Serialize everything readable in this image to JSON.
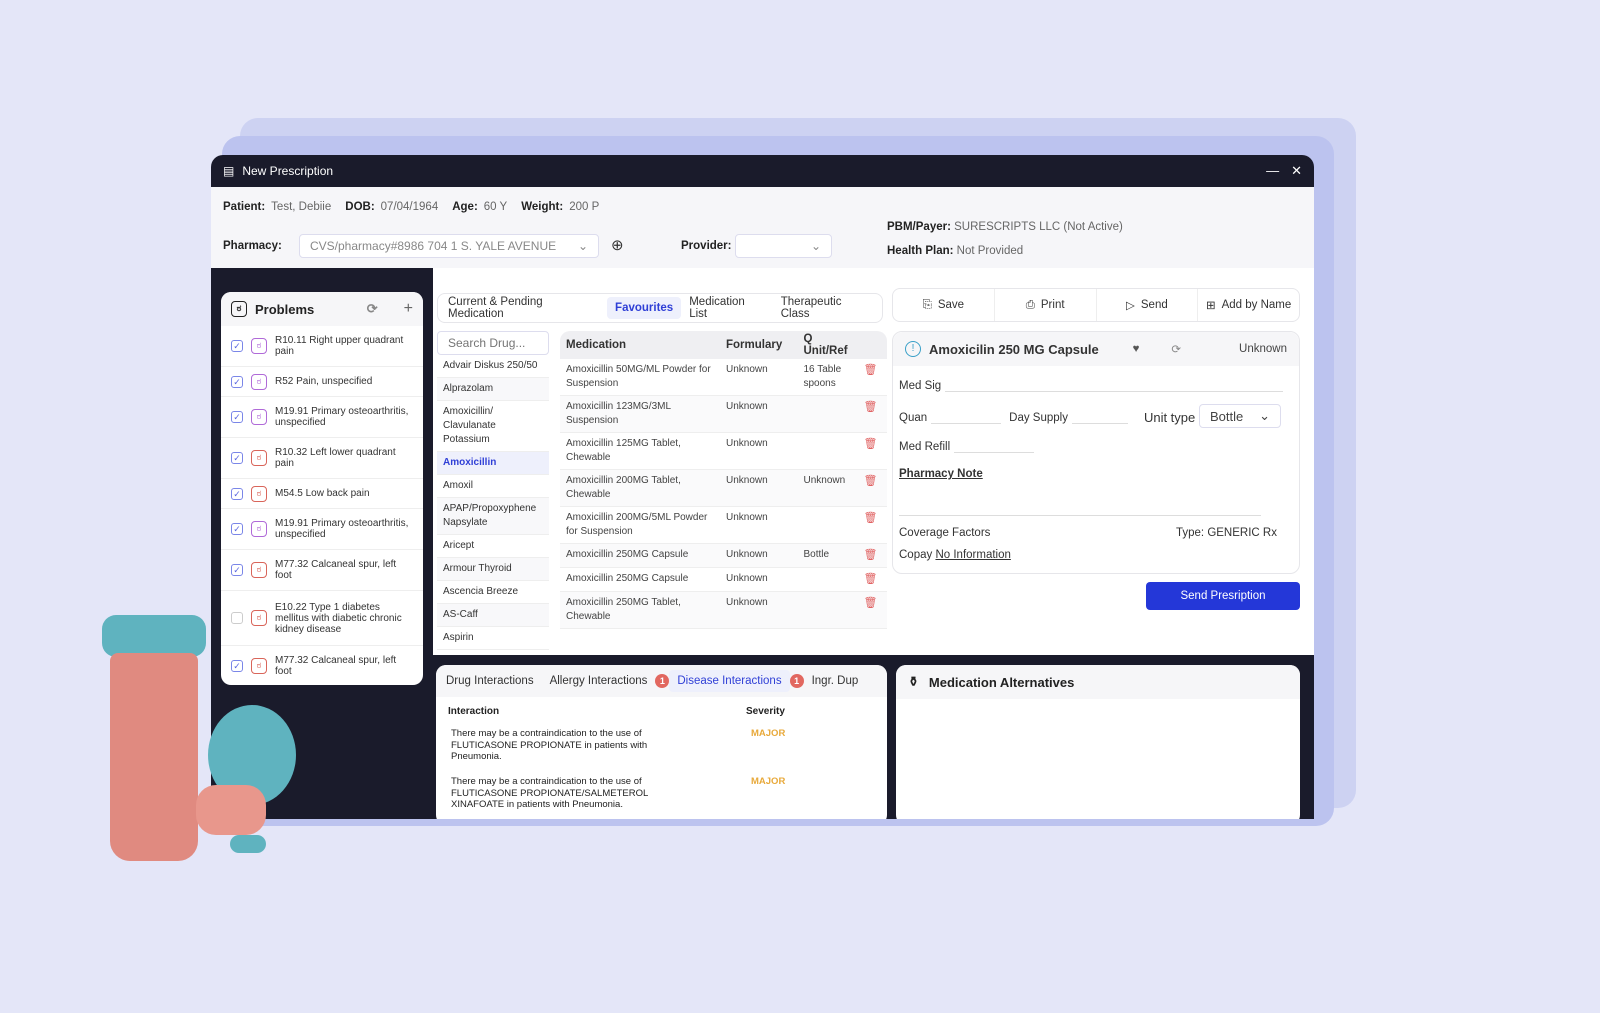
{
  "window": {
    "title": "New Prescription"
  },
  "patient": {
    "patient_label": "Patient:",
    "patient": "Test, Debiie",
    "dob_label": "DOB:",
    "dob": "07/04/1964",
    "age_label": "Age:",
    "age": "60 Y",
    "weight_label": "Weight:",
    "weight": "200 P"
  },
  "pharmacy": {
    "label": "Pharmacy:",
    "value": "CVS/pharmacy#8986 704 1 S. YALE AVENUE",
    "provider_label": "Provider:",
    "provider_value": ""
  },
  "payer": {
    "pbm_label": "PBM/Payer:",
    "pbm": "SURESCRIPTS LLC (Not Active)",
    "plan_label": "Health Plan:",
    "plan": "Not Provided"
  },
  "problems": {
    "title": "Problems",
    "items": [
      {
        "text": "R10.11 Right upper quadrant pain",
        "checked": true,
        "color": "#b06ad8"
      },
      {
        "text": "R52 Pain, unspecified",
        "checked": true,
        "color": "#b06ad8"
      },
      {
        "text": "M19.91 Primary osteoarthritis, unspecified",
        "checked": true,
        "color": "#b06ad8"
      },
      {
        "text": "R10.32 Left lower quadrant pain",
        "checked": true,
        "color": "#d9655a"
      },
      {
        "text": "M54.5 Low back pain",
        "checked": true,
        "color": "#d9655a"
      },
      {
        "text": "M19.91 Primary osteoarthritis, unspecified",
        "checked": true,
        "color": "#b06ad8"
      },
      {
        "text": "M77.32 Calcaneal spur, left foot",
        "checked": true,
        "color": "#d9655a"
      },
      {
        "text": "E10.22 Type 1 diabetes mellitus with diabetic chronic kidney disease",
        "checked": false,
        "color": "#d9655a"
      },
      {
        "text": "M77.32 Calcaneal spur, left foot",
        "checked": true,
        "color": "#d9655a"
      }
    ]
  },
  "med_tabs": [
    {
      "label": "Current & Pending Medication"
    },
    {
      "label": "Favourites",
      "active": true
    },
    {
      "label": "Medication List"
    },
    {
      "label": "Therapeutic Class"
    }
  ],
  "search": {
    "placeholder": "Search Drug..."
  },
  "drugs": [
    "Advair Diskus 250/50",
    "Alprazolam",
    "Amoxicillin/ Clavulanate Potassium",
    "Amoxicillin",
    "Amoxil",
    "APAP/Propoxyphene Napsylate",
    "Aricept",
    "Armour Thyroid",
    "Ascencia Breeze",
    "AS-Caff",
    "Aspirin"
  ],
  "selected_drug": "Amoxicillin",
  "med_table": {
    "headers": [
      "Medication",
      "Formulary",
      "Q Unit/Ref"
    ],
    "rows": [
      [
        "Amoxicillin 50MG/ML Powder for Suspension",
        "Unknown",
        "16 Table spoons"
      ],
      [
        "Amoxicillin 123MG/3ML Suspension",
        "Unknown",
        ""
      ],
      [
        "Amoxicillin 125MG Tablet, Chewable",
        "Unknown",
        ""
      ],
      [
        "Amoxicillin 200MG Tablet, Chewable",
        "Unknown",
        "Unknown"
      ],
      [
        "Amoxicillin 200MG/5ML Powder for Suspension",
        "Unknown",
        ""
      ],
      [
        "Amoxicillin 250MG Capsule",
        "Unknown",
        "Bottle"
      ],
      [
        "Amoxicillin 250MG Capsule",
        "Unknown",
        ""
      ],
      [
        "Amoxicillin 250MG Tablet, Chewable",
        "Unknown",
        ""
      ]
    ]
  },
  "actions": {
    "save": "Save",
    "print": "Print",
    "send": "Send",
    "add": "Add by Name"
  },
  "detail": {
    "title": "Amoxicilin 250 MG Capsule",
    "status": "Unknown",
    "med_sig": "Med Sig",
    "quan": "Quan",
    "day_supply": "Day Supply",
    "unit_type": "Unit type",
    "unit_value": "Bottle",
    "med_refill": "Med Refill",
    "pharmacy_note": "Pharmacy Note",
    "coverage": "Coverage Factors",
    "type": "Type: GENERIC Rx",
    "copay_label": "Copay",
    "copay": "No Information"
  },
  "send_button": "Send Presription",
  "interactions": {
    "tabs": [
      {
        "label": "Drug Interactions"
      },
      {
        "label": "Allergy Interactions",
        "badge": "1"
      },
      {
        "label": "Disease Interactions",
        "badge": "1",
        "active": true
      },
      {
        "label": "Ingr. Dup"
      }
    ],
    "col_interaction": "Interaction",
    "col_severity": "Severity",
    "rows": [
      {
        "text": "There may be a contraindication to the use of FLUTICASONE PROPIONATE in patients with Pneumonia.",
        "severity": "MAJOR"
      },
      {
        "text": "There may be a contraindication to the use of FLUTICASONE PROPIONATE/SALMETEROL XINAFOATE in patients with Pneumonia.",
        "severity": "MAJOR"
      }
    ]
  },
  "alternatives": {
    "title": "Medication Alternatives"
  },
  "colors": {
    "accent": "#2437d8",
    "dark": "#1a1b2b",
    "major": "#e8a93a",
    "badge": "#e2685f"
  }
}
